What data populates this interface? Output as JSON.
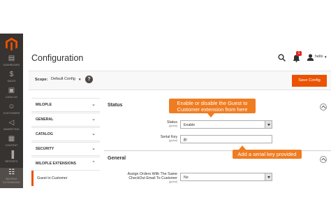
{
  "sidebar": {
    "items": [
      {
        "label": "Dashboard",
        "icon": "dashboard-icon",
        "glyph": "▤"
      },
      {
        "label": "Sales",
        "icon": "dollar-icon",
        "glyph": "$"
      },
      {
        "label": "Catalog",
        "icon": "cube-icon",
        "glyph": "▣"
      },
      {
        "label": "Customers",
        "icon": "person-icon",
        "glyph": "☺"
      },
      {
        "label": "Marketing",
        "icon": "megaphone-icon",
        "glyph": "◁"
      },
      {
        "label": "Content",
        "icon": "content-icon",
        "glyph": "▦"
      },
      {
        "label": "Reports",
        "icon": "bar-chart-icon",
        "glyph": "▐"
      },
      {
        "label": "Milople Extensions",
        "icon": "grid-icon",
        "glyph": "☷"
      }
    ]
  },
  "header": {
    "title": "Configuration",
    "notification_count": "1",
    "user_name": "hello"
  },
  "scope": {
    "label": "Scope:",
    "value": "Default Config",
    "save_label": "Save Config"
  },
  "tabs": [
    {
      "label": "MILOPLE"
    },
    {
      "label": "GENERAL"
    },
    {
      "label": "CATALOG"
    },
    {
      "label": "SECURITY"
    },
    {
      "label": "MILOPLE EXTENSIONS"
    }
  ],
  "active_subitem": "Guest to Customer",
  "sections": {
    "status": {
      "title": "Status",
      "status_label": "Status",
      "status_scope": "[global]",
      "status_value": "Enable",
      "serial_label": "Serial Key",
      "serial_scope": "[global]",
      "serial_value": "jiji"
    },
    "general": {
      "title": "General",
      "assign_label_line1": "Assign Orders With The Same",
      "assign_label_line2": "CheckOut Email To Customer",
      "assign_scope": "[global]",
      "assign_value": "No"
    }
  },
  "callouts": {
    "enable_line1": "Enable or disable the Guest to",
    "enable_line2": "Customer extension from here",
    "serial": "Add a serial key provided"
  },
  "colors": {
    "accent": "#eb5202",
    "callout": "#f07c21",
    "sidebar": "#373330"
  }
}
